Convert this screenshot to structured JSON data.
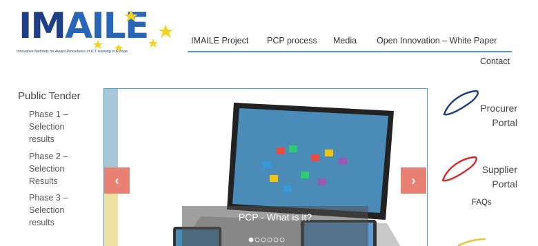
{
  "logo": {
    "title_part1": "IM",
    "title_part2": "AILE",
    "subtitle": "Innovative Methods for Award Procedures of ICT learning in Europe"
  },
  "nav": {
    "items": [
      "IMAILE Project",
      "PCP process",
      "Media",
      "Open Innovation – White Paper"
    ],
    "contact": "Contact"
  },
  "sidebar": {
    "title": "Public Tender",
    "phases": [
      "Phase 1 – Selection results",
      "Phase 2 – Selection Results",
      "Phase 3 – Selection results"
    ]
  },
  "slider": {
    "caption": "PCP - What is it?",
    "prev_icon": "chevron-left-icon",
    "next_icon": "chevron-right-icon",
    "slide_count": 6,
    "active_slide": 1
  },
  "portals": {
    "procurer": {
      "line1": "Procurer",
      "line2": "Portal",
      "color": "#1e3f86"
    },
    "supplier": {
      "line1": "Supplier",
      "line2": "Portal",
      "color": "#d62c2c"
    },
    "faqs": "FAQs",
    "partial": {
      "color": "#e5c533"
    }
  },
  "colors": {
    "accent": "#4aa3c3",
    "arrow": "#e98074"
  }
}
